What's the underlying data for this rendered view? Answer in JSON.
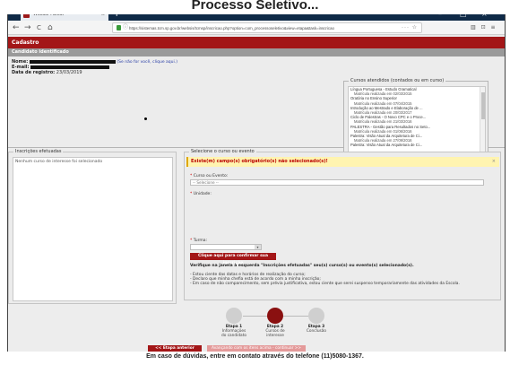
{
  "overlay": {
    "caption": "Processo Seletivo..."
  },
  "browser": {
    "tab_title": "WebSis TCMSP",
    "tab_close": "×",
    "new_tab": "+",
    "win_min": "–",
    "win_max": "□",
    "win_close": "×",
    "nav_back": "←",
    "nav_forward": "→",
    "nav_reload": "C",
    "nav_home": "⌂",
    "url": "https://sistemas.tcm.sp.gov.br/websis/tcmsp/inscricao.php?option=com_processoseletivo&view=etapa&task=inscricao",
    "url_actions": "··· ☆",
    "toolbar_right": "▥ ⊡ ≡"
  },
  "page": {
    "header": "Cadastro",
    "subheader": "Candidato identificado",
    "candidate": {
      "name_label": "Nome:",
      "not_you_link": "(Se não for você, clique aqui.)",
      "email_label": "E-mail:",
      "registration_label": "Data de registro:",
      "registration_date": "23/03/2019"
    },
    "courses_attended": {
      "legend": "Cursos atendidos (contados ou em curso)",
      "items": [
        {
          "title": "Língua Portuguesa - Estudo Gramatical",
          "detail": "Matrícula realizada em 02/03/2015"
        },
        {
          "title": "Oratória no Ensino Superior",
          "detail": "Matrícula realizada em 07/04/2015"
        },
        {
          "title": "Introdução ao Mestrado e Elaboração de ...",
          "detail": "Matrícula realizada em 20/03/2017"
        },
        {
          "title": "Ciclo de Palestras - O Novo CPC e o Proce...",
          "detail": "Matrícula realizada em 21/03/2016"
        },
        {
          "title": "PALESTRA - Gestão para Resultados no Seto...",
          "detail": "Matrícula realizada em 01/06/2016"
        },
        {
          "title": "Palestra: Visão Atual da Arquitetura de Ci...",
          "detail": "Matrícula realizada em 27/09/2016"
        },
        {
          "title": "Palestra: Visão Atual da Arquitetura de Ci...",
          "detail": ""
        }
      ]
    },
    "inscriptions": {
      "legend": "Inscrições efetuadas",
      "empty_text": "Nenhum curso de interesse foi selecionado"
    },
    "selection": {
      "legend": "Selecione o curso ou evento",
      "warning": "Existe(m) campo(s) obrigatório(s) não selecionado(s)!",
      "warning_close": "×",
      "required_mark": "*",
      "course_label": "Curso ou Evento:",
      "course_value": "-- Selecione --",
      "unit_label": "Unidade:",
      "shift_label": "Turma:",
      "confirm_button": "Clique aqui para confirmar sua inscrição",
      "verify_text": "Verifique na janela à esquerda \"Inscrições efetuadas\" seu(s) curso(s) ou evento(s) selecionado(s).",
      "declarations": [
        "- Estou ciente das datas e horários de realização do curso;",
        "- Declaro que minha chefia está de acordo com a minha inscrição;",
        "- Em caso de não comparecimento, sem prévia justificativa, estou ciente que serei suspenso temporariamente das atividades da Escola."
      ]
    },
    "steps": [
      {
        "title": "Etapa 1",
        "line1": "Informações",
        "line2": "do candidato",
        "active": false
      },
      {
        "title": "Etapa 2",
        "line1": "Cursos de",
        "line2": "interesse",
        "active": true
      },
      {
        "title": "Etapa 3",
        "line1": "Conclusão",
        "line2": "",
        "active": false
      }
    ],
    "prev_button": "<< Etapa anterior",
    "next_button": "Avançando com os itens acima - continuar >>"
  },
  "footer": {
    "text": "Em caso de dúvidas, entre em contato através do telefone (11)5080-1367."
  },
  "colors": {
    "brand": "#a31617",
    "tabbar": "#0f2a47",
    "warning_bg": "#fff4b0"
  }
}
